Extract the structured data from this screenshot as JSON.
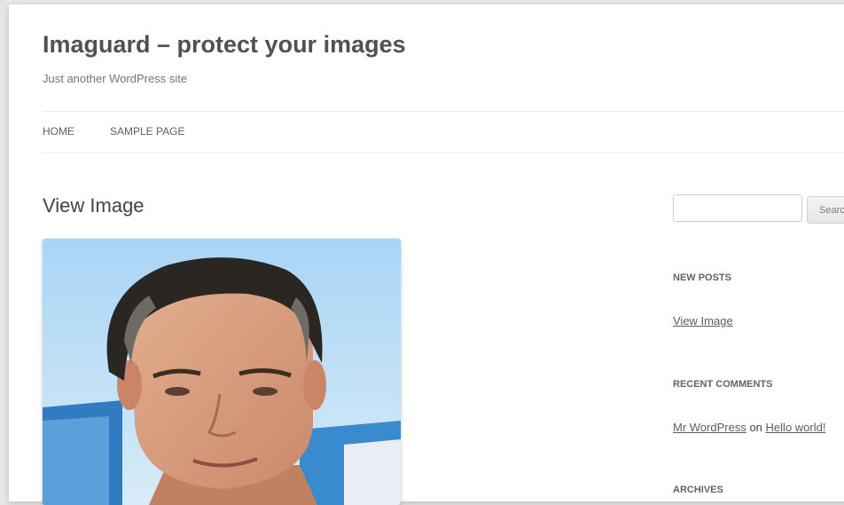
{
  "site": {
    "title": "Imaguard – protect your images",
    "description": "Just another WordPress site"
  },
  "nav": {
    "items": [
      {
        "label": "Home"
      },
      {
        "label": "Sample Page"
      }
    ]
  },
  "post": {
    "title": "View Image"
  },
  "sidebar": {
    "search": {
      "input_value": "",
      "button_label": "Search"
    },
    "new_posts": {
      "title": "New Posts",
      "items": [
        "View Image"
      ]
    },
    "recent_comments": {
      "title": "Recent Comments",
      "author": "Mr WordPress",
      "connector": "on",
      "post": "Hello world!"
    },
    "archives": {
      "title": "Archives"
    }
  },
  "colors": {
    "background": "#e6e6e6",
    "page": "#ffffff",
    "text": "#444444",
    "link": "#5e5e5e",
    "sky": "#a9d3f2"
  }
}
